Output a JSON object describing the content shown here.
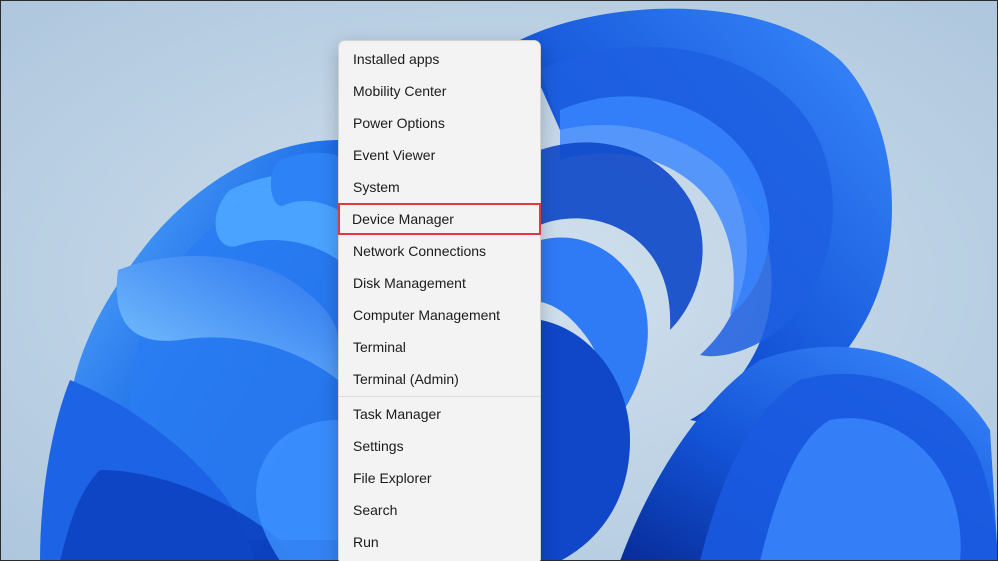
{
  "desktop": {
    "background_color": "#b9cfe3",
    "wallpaper": "windows-11-bloom-wallpaper"
  },
  "context_menu": {
    "group1": [
      {
        "label": "Installed apps",
        "name": "menu-item-installed-apps"
      },
      {
        "label": "Mobility Center",
        "name": "menu-item-mobility-center"
      },
      {
        "label": "Power Options",
        "name": "menu-item-power-options"
      },
      {
        "label": "Event Viewer",
        "name": "menu-item-event-viewer"
      },
      {
        "label": "System",
        "name": "menu-item-system"
      },
      {
        "label": "Device Manager",
        "name": "menu-item-device-manager",
        "highlighted": true
      },
      {
        "label": "Network Connections",
        "name": "menu-item-network-connections"
      },
      {
        "label": "Disk Management",
        "name": "menu-item-disk-management"
      },
      {
        "label": "Computer Management",
        "name": "menu-item-computer-management"
      },
      {
        "label": "Terminal",
        "name": "menu-item-terminal"
      },
      {
        "label": "Terminal (Admin)",
        "name": "menu-item-terminal-admin"
      }
    ],
    "group2": [
      {
        "label": "Task Manager",
        "name": "menu-item-task-manager"
      },
      {
        "label": "Settings",
        "name": "menu-item-settings"
      },
      {
        "label": "File Explorer",
        "name": "menu-item-file-explorer"
      },
      {
        "label": "Search",
        "name": "menu-item-search"
      },
      {
        "label": "Run",
        "name": "menu-item-run"
      }
    ],
    "highlight_color": "#e0383e"
  }
}
